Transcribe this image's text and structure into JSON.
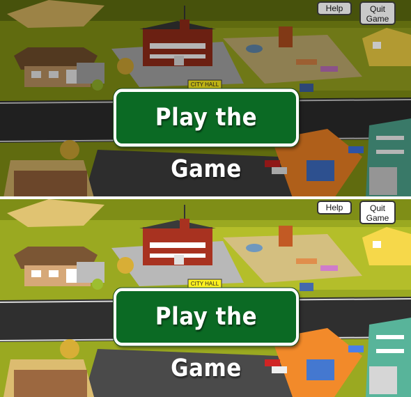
{
  "top_panel": {
    "help_label": "Help",
    "quit_label": "Quit Game",
    "play_label": "Play the Game",
    "city_hall_sign": "CITY HALL"
  },
  "bottom_panel": {
    "help_label": "Help",
    "quit_label": "Quit Game",
    "play_label": "Play the Game",
    "city_hall_sign": "CITY HALL"
  },
  "colors": {
    "play_button": "#0b6a24",
    "grass": "#8c9a17",
    "road": "#2c2c2c"
  }
}
